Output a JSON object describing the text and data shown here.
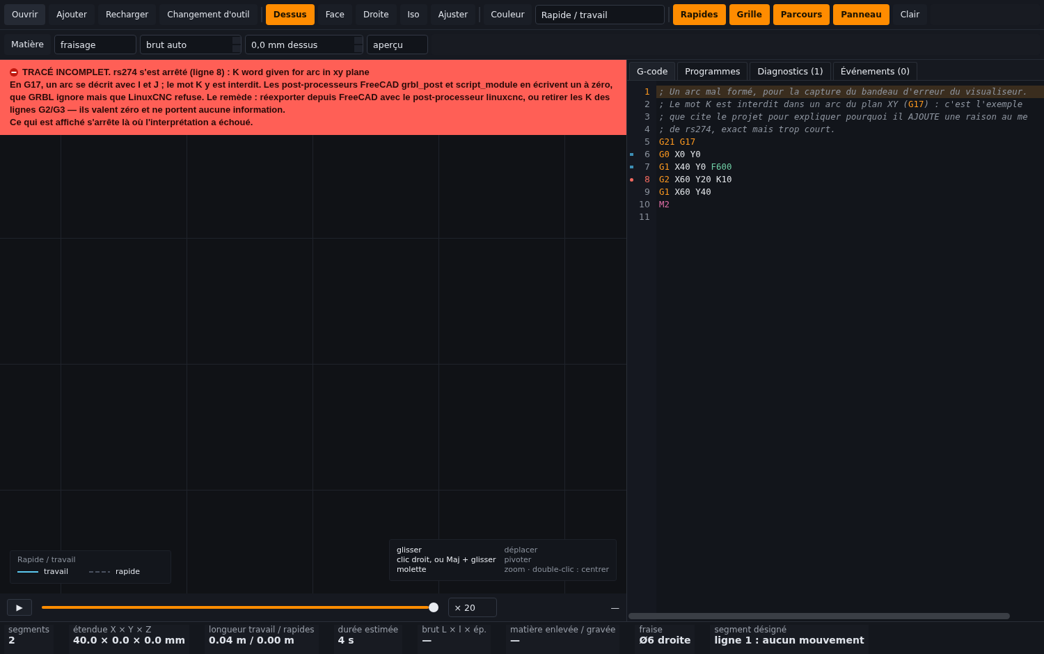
{
  "toolbar": {
    "file_buttons": [
      "Ouvrir",
      "Ajouter",
      "Recharger",
      "Changement d'outil"
    ],
    "views": [
      {
        "label": "Dessus",
        "selected": true
      },
      {
        "label": "Face",
        "selected": false
      },
      {
        "label": "Droite",
        "selected": false
      },
      {
        "label": "Iso",
        "selected": false
      }
    ],
    "fit_button": "Ajuster",
    "color_label": "Couleur",
    "color_field": {
      "value": "Rapide / travail"
    },
    "toggles": [
      {
        "label": "Rapides",
        "on": true
      },
      {
        "label": "Grille",
        "on": true
      },
      {
        "label": "Parcours",
        "on": true
      },
      {
        "label": "Panneau",
        "on": true
      },
      {
        "label": "Clair",
        "on": false
      }
    ]
  },
  "material_bar": {
    "label": "Matière",
    "fields": [
      {
        "kind": "text",
        "value": "fraisage"
      },
      {
        "kind": "spin",
        "value": "brut auto"
      },
      {
        "kind": "spin",
        "value": "0,0 mm dessus"
      },
      {
        "kind": "text",
        "value": "aperçu"
      }
    ]
  },
  "error_banner": {
    "title": "TRACÉ INCOMPLET. rs274 s'est arrêté (ligne 8) : K word given for arc in xy plane",
    "message": "En G17, un arc se décrit avec I et J ; le mot K y est interdit. Les post-processeurs FreeCAD grbl_post et script_module en écrivent un à zéro, que GRBL ignore mais que LinuxCNC refuse. Le remède : réexporter depuis FreeCAD avec le post-processeur linuxcnc, ou retirer les K des lignes G2/G3 — ils valent zéro et ne portent aucune information.",
    "note": "Ce qui est affiché s'arrête là où l'interprétation a échoué."
  },
  "legend": {
    "title": "Rapide / travail",
    "items": [
      {
        "label": "travail",
        "kind": "solid",
        "color": "#5bc8ef"
      },
      {
        "label": "rapide",
        "kind": "dashed",
        "color": "#4a5160"
      }
    ]
  },
  "hints": [
    {
      "action": "glisser",
      "effect": "déplacer"
    },
    {
      "action": "clic droit, ou Maj + glisser",
      "effect": "pivoter"
    },
    {
      "action": "molette",
      "effect": "zoom · double-clic : centrer"
    }
  ],
  "playback": {
    "play": "▶",
    "level": 1,
    "speed": "× 20",
    "collapse": "—"
  },
  "editor": {
    "tabs": [
      {
        "label": "G-code",
        "selected": true
      },
      {
        "label": "Programmes",
        "selected": false
      },
      {
        "label": "Diagnostics (1)",
        "selected": false
      },
      {
        "label": "Événements (0)",
        "selected": false
      }
    ],
    "lines": [
      {
        "number": "1",
        "current": true,
        "kind": "plain",
        "tokens": [
          {
            "kind": "comment",
            "text": "; Un arc mal formé, pour la capture du bandeau d'erreur du visualiseur."
          }
        ]
      },
      {
        "number": "2",
        "current": false,
        "kind": "plain",
        "tokens": [
          {
            "kind": "comment",
            "text": "; Le mot K est interdit dans un arc du plan XY ("
          },
          {
            "kind": "command",
            "text": "G17"
          },
          {
            "kind": "comment",
            "text": ") : c'est l'exemple"
          }
        ]
      },
      {
        "number": "3",
        "current": false,
        "kind": "plain",
        "tokens": [
          {
            "kind": "comment",
            "text": "; que cite le projet pour expliquer pourquoi il AJOUTE une raison au me"
          }
        ]
      },
      {
        "number": "4",
        "current": false,
        "kind": "plain",
        "tokens": [
          {
            "kind": "comment",
            "text": "; de rs274, exact mais trop court."
          }
        ]
      },
      {
        "number": "5",
        "current": false,
        "kind": "plain",
        "tokens": [
          {
            "kind": "command",
            "text": "G21 G17"
          }
        ]
      },
      {
        "number": "6",
        "current": false,
        "kind": "step",
        "tokens": [
          {
            "kind": "command",
            "text": "G0"
          },
          {
            "kind": "plain",
            "text": " X0 Y0"
          }
        ]
      },
      {
        "number": "7",
        "current": false,
        "kind": "step",
        "tokens": [
          {
            "kind": "command",
            "text": "G1"
          },
          {
            "kind": "plain",
            "text": " X40 Y0 "
          },
          {
            "kind": "feed",
            "text": "F600"
          }
        ]
      },
      {
        "number": "8",
        "current": false,
        "kind": "error",
        "tokens": [
          {
            "kind": "command",
            "text": "G2"
          },
          {
            "kind": "plain",
            "text": " X60 Y20 K10"
          }
        ]
      },
      {
        "number": "9",
        "current": false,
        "kind": "plain",
        "tokens": [
          {
            "kind": "command",
            "text": "G1"
          },
          {
            "kind": "plain",
            "text": " X60 Y40"
          }
        ]
      },
      {
        "number": "10",
        "current": false,
        "kind": "plain",
        "tokens": [
          {
            "kind": "misc",
            "text": "M2"
          }
        ]
      },
      {
        "number": "11",
        "current": false,
        "kind": "plain"
      }
    ]
  },
  "status_bar": [
    {
      "label": "segments",
      "value": "2"
    },
    {
      "label": "étendue  X × Y × Z",
      "value": "40.0 × 0.0 × 0.0 mm"
    },
    {
      "label": "longueur travail / rapides",
      "value": "0.04 m  /  0.00 m"
    },
    {
      "label": "durée estimée",
      "value": "4 s"
    },
    {
      "label": "brut  L × l × ép.",
      "value": "—"
    },
    {
      "label": "matière enlevée / gravée",
      "value": "—"
    },
    {
      "label": "fraise",
      "value": "Ø6 droite"
    },
    {
      "label": "segment désigné",
      "value": "ligne 1 : aucun mouvement"
    }
  ]
}
